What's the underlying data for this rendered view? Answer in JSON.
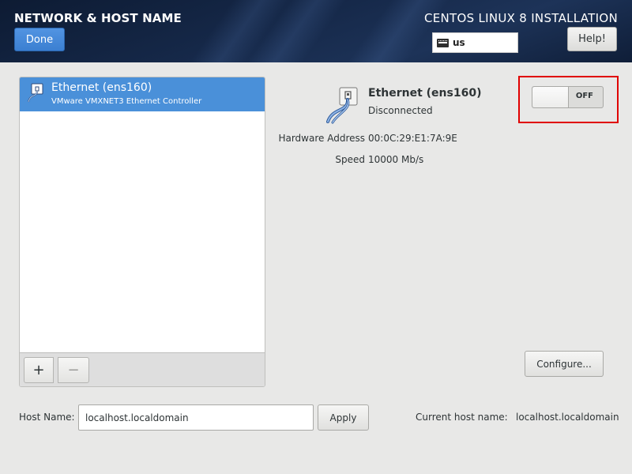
{
  "header": {
    "page_title": "NETWORK & HOST NAME",
    "done_label": "Done",
    "install_title": "CENTOS LINUX 8 INSTALLATION",
    "keyboard_layout": "us",
    "help_label": "Help!"
  },
  "devices": [
    {
      "name": "Ethernet (ens160)",
      "description": "VMware VMXNET3 Ethernet Controller",
      "selected": true
    }
  ],
  "list_toolbar": {
    "add_label": "+",
    "remove_label": "−"
  },
  "detail": {
    "device_name": "Ethernet (ens160)",
    "status": "Disconnected",
    "hardware_address_label": "Hardware Address",
    "hardware_address": "00:0C:29:E1:7A:9E",
    "speed_label": "Speed",
    "speed": "10000 Mb/s",
    "switch_state": "OFF",
    "configure_label": "Configure..."
  },
  "hostname": {
    "label": "Host Name:",
    "value": "localhost.localdomain",
    "apply_label": "Apply",
    "current_label": "Current host name:",
    "current_value": "localhost.localdomain"
  },
  "colors": {
    "accent": "#4a90d9",
    "header_bg": "#16294a",
    "highlight": "#e00000"
  },
  "icons": {
    "keyboard": "keyboard-icon",
    "ethernet": "ethernet-icon"
  }
}
